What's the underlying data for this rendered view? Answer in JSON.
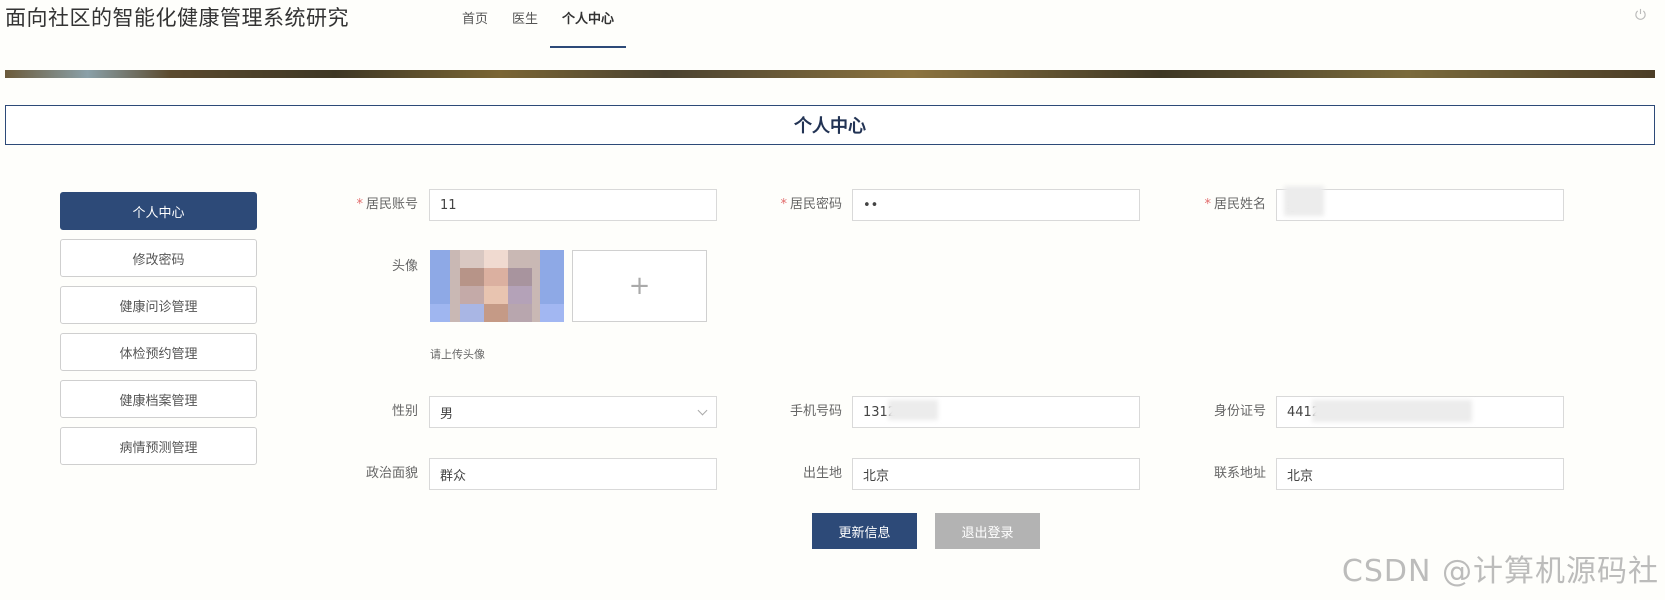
{
  "header": {
    "app_title": "面向社区的智能化健康管理系统研究",
    "nav": [
      {
        "label": "首页"
      },
      {
        "label": "医生"
      },
      {
        "label": "个人中心"
      }
    ]
  },
  "page": {
    "title": "个人中心"
  },
  "sidebar": {
    "items": [
      {
        "label": "个人中心"
      },
      {
        "label": "修改密码"
      },
      {
        "label": "健康问诊管理"
      },
      {
        "label": "体检预约管理"
      },
      {
        "label": "健康档案管理"
      },
      {
        "label": "病情预测管理"
      }
    ]
  },
  "form": {
    "account": {
      "label": "居民账号",
      "value": "11"
    },
    "password": {
      "label": "居民密码",
      "value": "••"
    },
    "name": {
      "label": "居民姓名",
      "value": "李"
    },
    "avatar": {
      "label": "头像",
      "hint": "请上传头像"
    },
    "gender": {
      "label": "性别",
      "value": "男"
    },
    "phone": {
      "label": "手机号码",
      "value": "1312"
    },
    "idcard": {
      "label": "身份证号",
      "value": "4412"
    },
    "political": {
      "label": "政治面貌",
      "value": "群众"
    },
    "birthplace": {
      "label": "出生地",
      "value": "北京"
    },
    "address": {
      "label": "联系地址",
      "value": "北京"
    }
  },
  "actions": {
    "update_label": "更新信息",
    "logout_label": "退出登录"
  },
  "watermark": "CSDN @计算机源码社"
}
